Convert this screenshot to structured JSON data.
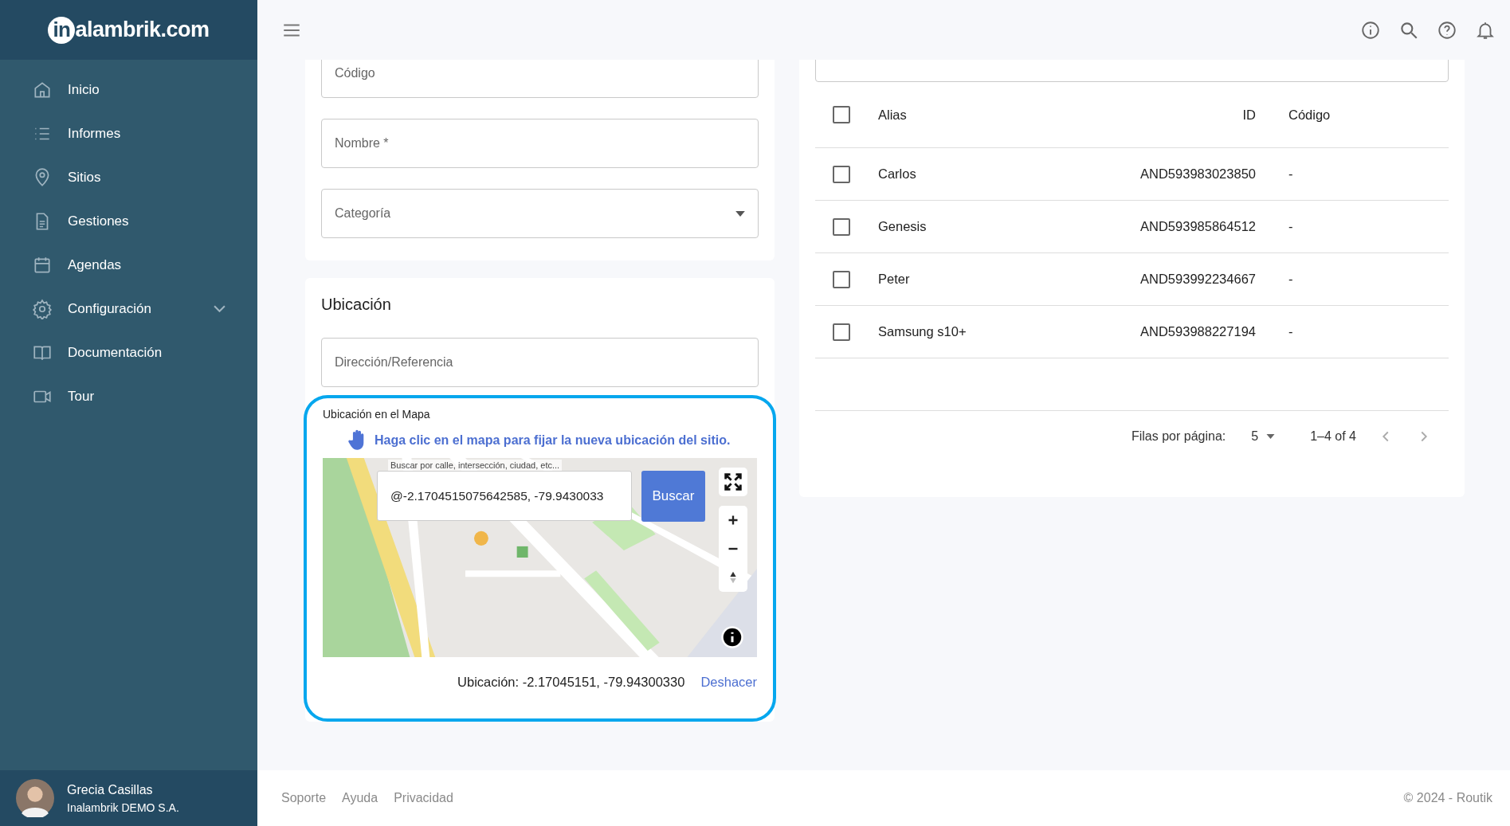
{
  "logo": {
    "mark": "in",
    "text": "alambrik.com"
  },
  "sidebar": {
    "items": [
      {
        "label": "Inicio",
        "has_submenu": false
      },
      {
        "label": "Informes",
        "has_submenu": false
      },
      {
        "label": "Sitios",
        "has_submenu": false
      },
      {
        "label": "Gestiones",
        "has_submenu": false
      },
      {
        "label": "Agendas",
        "has_submenu": false
      },
      {
        "label": "Configuración",
        "has_submenu": true
      },
      {
        "label": "Documentación",
        "has_submenu": false
      },
      {
        "label": "Tour",
        "has_submenu": false
      }
    ],
    "user": {
      "name": "Grecia Casillas",
      "company": "Inalambrik DEMO S.A."
    }
  },
  "form": {
    "fields": [
      {
        "placeholder": "Código",
        "kind": "text"
      },
      {
        "placeholder": "Nombre *",
        "kind": "text"
      },
      {
        "placeholder": "Categoría",
        "kind": "select"
      }
    ]
  },
  "location": {
    "title": "Ubicación",
    "address_placeholder": "Dirección/Referencia",
    "map_label": "Ubicación en el Mapa",
    "hint": "Haga clic en el mapa para fijar la nueva ubicación del sitio.",
    "search_label": "Buscar por calle, intersección, ciudad, etc...",
    "search_value": "@-2.1704515075642585, -79.9430033",
    "search_button": "Buscar",
    "reading": "Ubicación: -2.17045151, -79.94300330",
    "undo": "Deshacer"
  },
  "table": {
    "columns": [
      "Alias",
      "ID",
      "Código"
    ],
    "all_checked": false,
    "rows": [
      {
        "alias": "Carlos",
        "id": "AND593983023850",
        "code": "-",
        "checked": false
      },
      {
        "alias": "Genesis",
        "id": "AND593985864512",
        "code": "-",
        "checked": false
      },
      {
        "alias": "Peter",
        "id": "AND593992234667",
        "code": "-",
        "checked": false
      },
      {
        "alias": "Samsung s10+",
        "id": "AND593988227194",
        "code": "-",
        "checked": false
      }
    ],
    "rows_per_page_label": "Filas por página:",
    "rows_per_page": "5",
    "range": "1–4 of 4"
  },
  "footer": {
    "links": [
      "Soporte",
      "Ayuda",
      "Privacidad"
    ],
    "copyright": "© 2024 - Routik"
  }
}
